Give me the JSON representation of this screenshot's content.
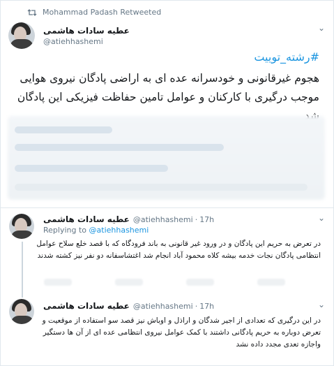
{
  "retweet": {
    "label": "Mohammad Padash Retweeted"
  },
  "main_tweet": {
    "name": "عطیه سادات هاشمی",
    "handle": "@atiehhashemi",
    "hashtag": "#رشته_توییت",
    "text": "هجوم غیرقانونی و خودسرانه عده ای به اراضی پادگان نیروی هوایی موجب درگیری با کارکنان و عوامل تامین حفاظت فیزیکی این پادگان شد"
  },
  "replies": [
    {
      "name": "عطیه سادات هاشمی",
      "handle": "@atiehhashemi",
      "separator": "·",
      "time": "17h",
      "replying_prefix": "Replying to",
      "replying_handle": "@atiehhashemi",
      "text": "در تعرض به حریم این پادگان و در ورود غیر قانونی به باند فرودگاه که با قصد خلع سلاح عوامل انتظامی پادگان نجات خدمه بیشه کلاه محمود آباد انجام شد اغتشاسفانه دو نفر نیز کشته شدند"
    },
    {
      "name": "عطیه سادات هاشمی",
      "handle": "@atiehhashemi",
      "separator": "·",
      "time": "17h",
      "text": "در این درگیری که تعدادی از اجیر شدگان و اراذل و اوباش نیز قصد سو استفاده از موقعیت و تعرض دوباره به حریم پادگانی داشتند با کمک عوامل نیروی انتظامی عده ای از آن ها دستگیر واجازه تعدی مجدد داده نشد"
    }
  ],
  "colors": {
    "link": "#1b95e0",
    "muted": "#657786",
    "border": "#e1e8ed"
  }
}
